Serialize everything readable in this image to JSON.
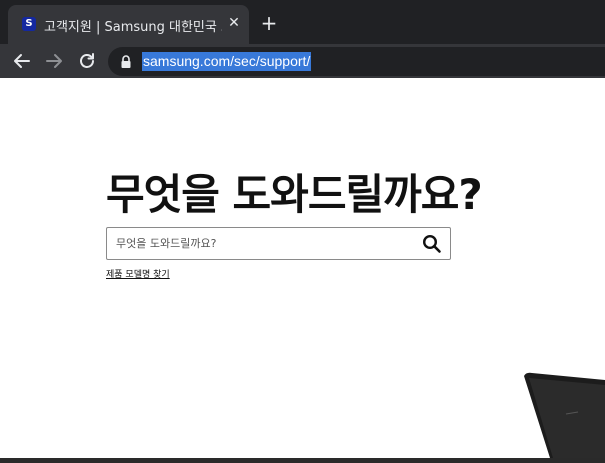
{
  "browser": {
    "tab": {
      "title": "고객지원 | Samsung 대한민국 고객지원",
      "favicon": "S",
      "close": "✕"
    },
    "new_tab": "+",
    "address": {
      "url": "samsung.com/sec/support/"
    }
  },
  "page": {
    "heading": "무엇을 도와드릴까요?",
    "search": {
      "placeholder": "무엇을 도와드릴까요?"
    },
    "model_link": "제품 모델명 찾기"
  },
  "colors": {
    "brand": "#1428a0",
    "selection": "#3879d9",
    "tab_bg": "#202124",
    "toolbar_bg": "#35363a"
  }
}
